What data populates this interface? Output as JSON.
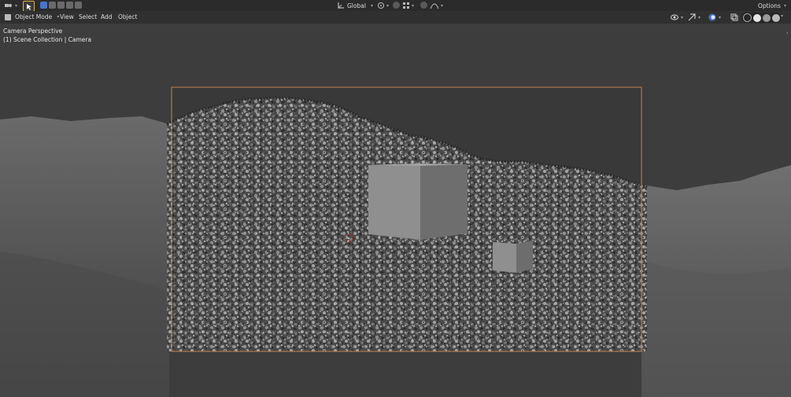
{
  "toolbar": {
    "transform_orientation": "Global",
    "options_label": "Options"
  },
  "header": {
    "mode_label": "Object Mode",
    "menu_view": "View",
    "menu_select": "Select",
    "menu_add": "Add",
    "menu_object": "Object"
  },
  "viewport": {
    "view_name": "Camera Perspective",
    "collection_info": "(1) Scene Collection | Camera"
  },
  "colors": {
    "camera_frame": "#c9814a",
    "accent_blue": "#4a75c8",
    "active_tool": "#e0b43c"
  }
}
